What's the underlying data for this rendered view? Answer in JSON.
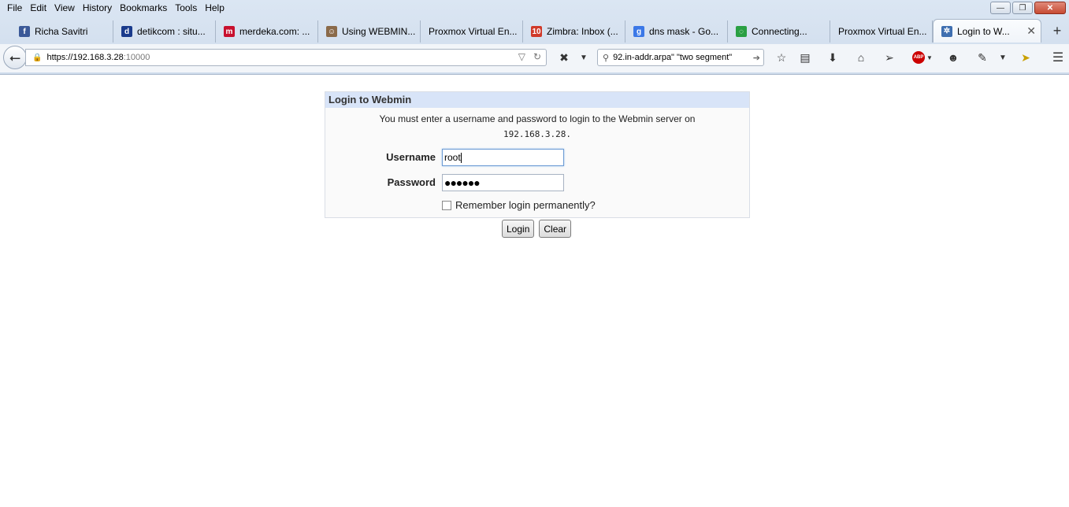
{
  "menu": [
    "File",
    "Edit",
    "View",
    "History",
    "Bookmarks",
    "Tools",
    "Help"
  ],
  "window_controls": {
    "minimize": "—",
    "maximize": "❐",
    "close": "✕"
  },
  "tabs": [
    {
      "label": "Richa Savitri",
      "icon": "facebook-icon",
      "icon_text": "f",
      "icon_color": "#3b5998"
    },
    {
      "label": "detikcom : situ...",
      "icon": "detik-icon",
      "icon_text": "d",
      "icon_color": "#1a3b8c"
    },
    {
      "label": "merdeka.com: ...",
      "icon": "merdeka-icon",
      "icon_text": "m",
      "icon_color": "#c8102e"
    },
    {
      "label": "Using WEBMIN...",
      "icon": "avatar-icon",
      "icon_text": "☺",
      "icon_color": "#8a6a4a"
    },
    {
      "label": "Proxmox Virtual En...",
      "icon": "",
      "icon_text": "",
      "icon_color": ""
    },
    {
      "label": "Zimbra: Inbox (...",
      "icon": "calendar-icon",
      "icon_text": "10",
      "icon_color": "#d03a2a"
    },
    {
      "label": "dns mask - Go...",
      "icon": "google-icon",
      "icon_text": "g",
      "icon_color": "#3b78e7"
    },
    {
      "label": "Connecting...",
      "icon": "loading-icon",
      "icon_text": "◌",
      "icon_color": "#2aa043"
    },
    {
      "label": "Proxmox Virtual En...",
      "icon": "",
      "icon_text": "",
      "icon_color": ""
    },
    {
      "label": "Login to W...",
      "icon": "webmin-icon",
      "icon_text": "✲",
      "icon_color": "#3f6fb0",
      "active": true
    }
  ],
  "new_tab": "+",
  "url": {
    "host": "https://192.168.3.28",
    "port": ":10000"
  },
  "search": {
    "value": "92.in-addr.arpa\" \"two segment\""
  },
  "page": {
    "title": "Login to Webmin",
    "message": "You must enter a username and password to login to the Webmin server on",
    "server": "192.168.3.28.",
    "username_label": "Username",
    "username_value": "root",
    "password_label": "Password",
    "password_value": "●●●●●●",
    "remember_label": "Remember login permanently?",
    "remember_checked": false,
    "login_button": "Login",
    "clear_button": "Clear"
  }
}
